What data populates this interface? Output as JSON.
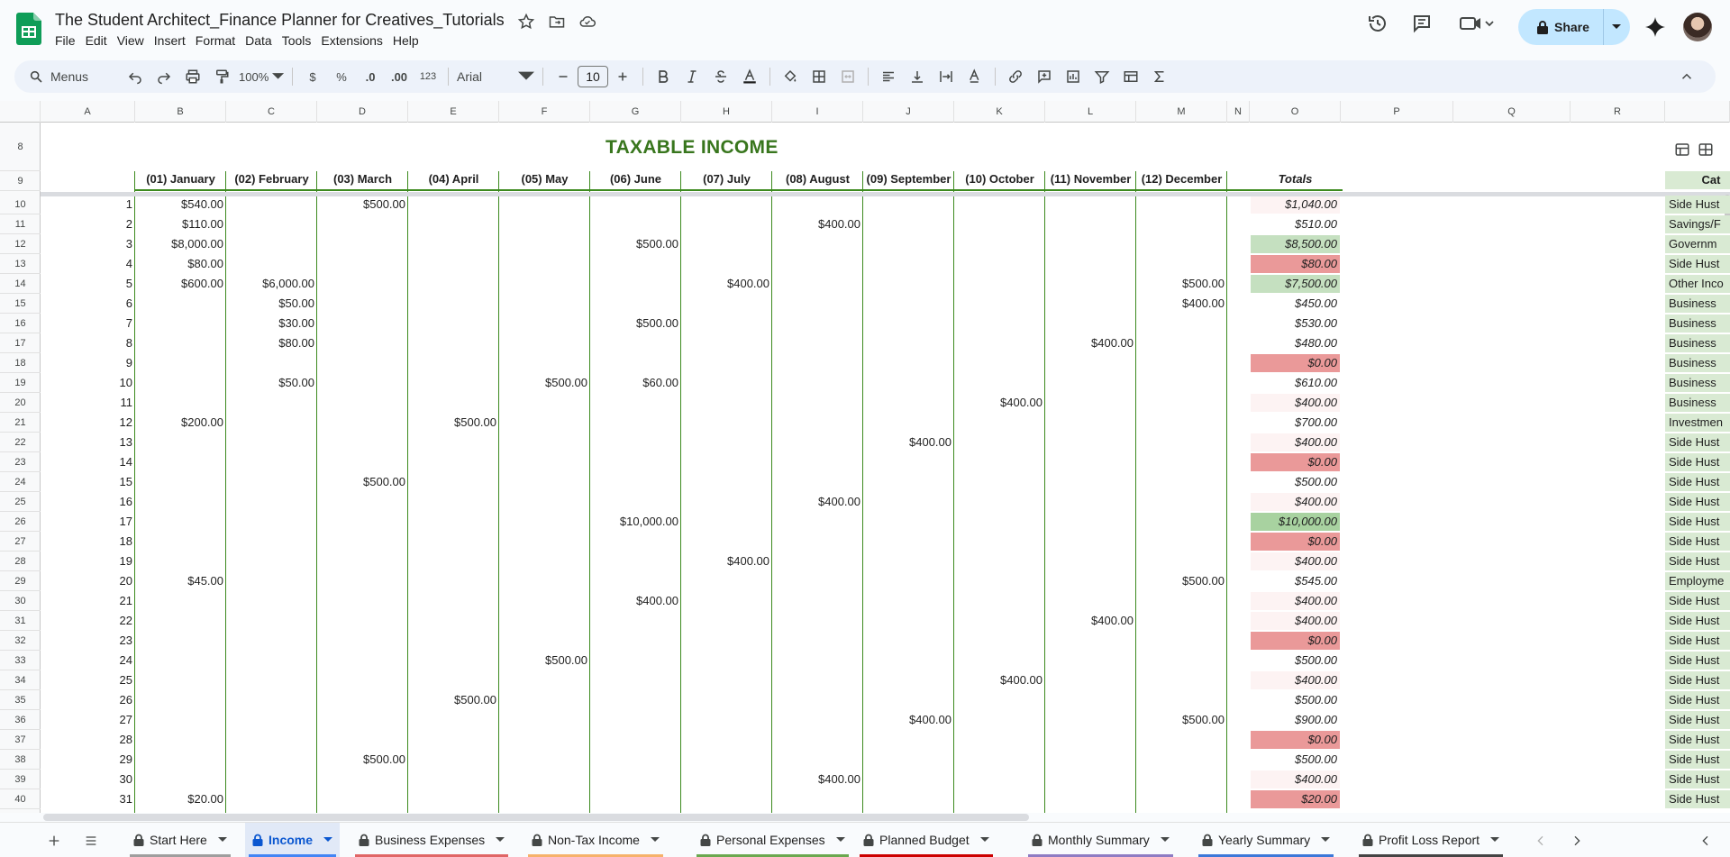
{
  "doc": {
    "title": "The Student Architect_Finance Planner for Creatives_Tutorials"
  },
  "menu": [
    "File",
    "Edit",
    "View",
    "Insert",
    "Format",
    "Data",
    "Tools",
    "Extensions",
    "Help"
  ],
  "share": {
    "label": "Share"
  },
  "toolbar": {
    "search": "Menus",
    "zoom": "100%",
    "currency": "$",
    "percent": "%",
    "dec_less": ".0",
    "dec_more": ".00",
    "number_format": "123",
    "font": "Arial",
    "font_size": "10"
  },
  "columns": [
    "A",
    "B",
    "C",
    "D",
    "E",
    "F",
    "G",
    "H",
    "I",
    "J",
    "K",
    "L",
    "M",
    "N",
    "O",
    "P",
    "Q",
    "R"
  ],
  "sheet": {
    "title": "TAXABLE INCOME",
    "month_headers": [
      "(01) January",
      "(02) February",
      "(03) March",
      "(04) April",
      "(05) May",
      "(06) June",
      "(07) July",
      "(08) August",
      "(09) September",
      "(10) October",
      "(11) November",
      "(12) December",
      "Totals"
    ],
    "category_header": "Cat",
    "rows": [
      {
        "row": "10",
        "n": "1",
        "vals": {
          "B": "$540.00",
          "D": "$500.00"
        },
        "total": "$1,040.00",
        "tint": "light",
        "cat": "Side Hust"
      },
      {
        "row": "11",
        "n": "2",
        "vals": {
          "B": "$110.00",
          "I": "$400.00"
        },
        "total": "$510.00",
        "tint": "none",
        "cat": "Savings/F"
      },
      {
        "row": "12",
        "n": "3",
        "vals": {
          "B": "$8,000.00",
          "G": "$500.00"
        },
        "total": "$8,500.00",
        "tint": "green",
        "cat": "Governm"
      },
      {
        "row": "13",
        "n": "4",
        "vals": {
          "B": "$80.00"
        },
        "total": "$80.00",
        "tint": "red",
        "cat": "Side Hust"
      },
      {
        "row": "14",
        "n": "5",
        "vals": {
          "B": "$600.00",
          "C": "$6,000.00",
          "H": "$400.00",
          "M": "$500.00"
        },
        "total": "$7,500.00",
        "tint": "green",
        "cat": "Other Inco"
      },
      {
        "row": "15",
        "n": "6",
        "vals": {
          "C": "$50.00",
          "M": "$400.00"
        },
        "total": "$450.00",
        "tint": "none",
        "cat": "Business"
      },
      {
        "row": "16",
        "n": "7",
        "vals": {
          "C": "$30.00",
          "G": "$500.00"
        },
        "total": "$530.00",
        "tint": "none",
        "cat": "Business"
      },
      {
        "row": "17",
        "n": "8",
        "vals": {
          "C": "$80.00",
          "L": "$400.00"
        },
        "total": "$480.00",
        "tint": "none",
        "cat": "Business"
      },
      {
        "row": "18",
        "n": "9",
        "vals": {},
        "total": "$0.00",
        "tint": "red",
        "cat": "Business"
      },
      {
        "row": "19",
        "n": "10",
        "vals": {
          "C": "$50.00",
          "F": "$500.00",
          "G": "$60.00"
        },
        "total": "$610.00",
        "tint": "none",
        "cat": "Business"
      },
      {
        "row": "20",
        "n": "11",
        "vals": {
          "K": "$400.00"
        },
        "total": "$400.00",
        "tint": "light",
        "cat": "Business"
      },
      {
        "row": "21",
        "n": "12",
        "vals": {
          "B": "$200.00",
          "E": "$500.00"
        },
        "total": "$700.00",
        "tint": "none",
        "cat": "Investmen"
      },
      {
        "row": "22",
        "n": "13",
        "vals": {
          "J": "$400.00"
        },
        "total": "$400.00",
        "tint": "light",
        "cat": "Side Hust"
      },
      {
        "row": "23",
        "n": "14",
        "vals": {},
        "total": "$0.00",
        "tint": "red",
        "cat": "Side Hust"
      },
      {
        "row": "24",
        "n": "15",
        "vals": {
          "D": "$500.00"
        },
        "total": "$500.00",
        "tint": "none",
        "cat": "Side Hust"
      },
      {
        "row": "25",
        "n": "16",
        "vals": {
          "I": "$400.00"
        },
        "total": "$400.00",
        "tint": "light",
        "cat": "Side Hust"
      },
      {
        "row": "26",
        "n": "17",
        "vals": {
          "G": "$10,000.00"
        },
        "total": "$10,000.00",
        "tint": "darkgreen",
        "cat": "Side Hust"
      },
      {
        "row": "27",
        "n": "18",
        "vals": {},
        "total": "$0.00",
        "tint": "red",
        "cat": "Side Hust"
      },
      {
        "row": "28",
        "n": "19",
        "vals": {
          "H": "$400.00"
        },
        "total": "$400.00",
        "tint": "light",
        "cat": "Side Hust"
      },
      {
        "row": "29",
        "n": "20",
        "vals": {
          "B": "$45.00",
          "M": "$500.00"
        },
        "total": "$545.00",
        "tint": "none",
        "cat": "Employme"
      },
      {
        "row": "30",
        "n": "21",
        "vals": {
          "G": "$400.00"
        },
        "total": "$400.00",
        "tint": "light",
        "cat": "Side Hust"
      },
      {
        "row": "31",
        "n": "22",
        "vals": {
          "L": "$400.00"
        },
        "total": "$400.00",
        "tint": "light",
        "cat": "Side Hust"
      },
      {
        "row": "32",
        "n": "23",
        "vals": {},
        "total": "$0.00",
        "tint": "red",
        "cat": "Side Hust"
      },
      {
        "row": "33",
        "n": "24",
        "vals": {
          "F": "$500.00"
        },
        "total": "$500.00",
        "tint": "none",
        "cat": "Side Hust"
      },
      {
        "row": "34",
        "n": "25",
        "vals": {
          "K": "$400.00"
        },
        "total": "$400.00",
        "tint": "light",
        "cat": "Side Hust"
      },
      {
        "row": "35",
        "n": "26",
        "vals": {
          "E": "$500.00"
        },
        "total": "$500.00",
        "tint": "none",
        "cat": "Side Hust"
      },
      {
        "row": "36",
        "n": "27",
        "vals": {
          "J": "$400.00",
          "M": "$500.00"
        },
        "total": "$900.00",
        "tint": "none",
        "cat": "Side Hust"
      },
      {
        "row": "37",
        "n": "28",
        "vals": {},
        "total": "$0.00",
        "tint": "red",
        "cat": "Side Hust"
      },
      {
        "row": "38",
        "n": "29",
        "vals": {
          "D": "$500.00"
        },
        "total": "$500.00",
        "tint": "none",
        "cat": "Side Hust"
      },
      {
        "row": "39",
        "n": "30",
        "vals": {
          "I": "$400.00"
        },
        "total": "$400.00",
        "tint": "light",
        "cat": "Side Hust"
      },
      {
        "row": "40",
        "n": "31",
        "vals": {
          "B": "$20.00"
        },
        "total": "$20.00",
        "tint": "red",
        "cat": "Side Hust"
      }
    ]
  },
  "tabs": [
    {
      "label": "Start Here",
      "color": "#9e9e9e",
      "active": false
    },
    {
      "label": "Income",
      "color": "#4285f4",
      "active": true
    },
    {
      "label": "Business Expenses",
      "color": "#e06666",
      "active": false
    },
    {
      "label": "Non-Tax Income",
      "color": "#f6b26b",
      "active": false
    },
    {
      "label": "Personal Expenses",
      "color": "#6aa84f",
      "active": false
    },
    {
      "label": "Planned Budget",
      "color": "#cc0000",
      "active": false
    },
    {
      "label": "Monthly Summary",
      "color": "#8e7cc3",
      "active": false
    },
    {
      "label": "Yearly Summary",
      "color": "#3c78d8",
      "active": false
    },
    {
      "label": "Profit Loss Report",
      "color": "#444444",
      "active": false
    }
  ],
  "tint_colors": {
    "light": "#fdf3f3",
    "red": "#ea9999",
    "green": "#c5e0c0",
    "darkgreen": "#a8d2a0",
    "none": "#ffffff"
  }
}
